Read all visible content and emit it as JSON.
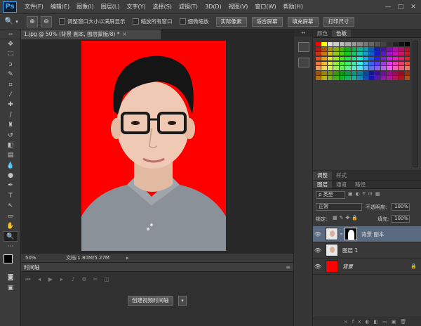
{
  "app": {
    "logo": "Ps"
  },
  "menu": [
    "文件(F)",
    "编辑(E)",
    "图像(I)",
    "图层(L)",
    "文字(Y)",
    "选择(S)",
    "滤镜(T)",
    "3D(D)",
    "视图(V)",
    "窗口(W)",
    "帮助(H)"
  ],
  "window_controls": [
    "—",
    "□",
    "✕"
  ],
  "options": {
    "chk1": "调整窗口大小以满屏显示",
    "chk2": "缩放所有窗口",
    "chk3": "细微缩放",
    "btn_actual": "实际像素",
    "btn_fit": "适合屏幕",
    "btn_fill": "填充屏幕",
    "btn_print": "打印尺寸"
  },
  "document": {
    "tab_title": "1.jpg @ 50% (背景 副本, 图层蒙版/8) *",
    "close": "×"
  },
  "status": {
    "zoom": "50%",
    "doc": "文档:1.80M/5.27M"
  },
  "timeline": {
    "title": "时间轴",
    "create_button": "创建视频时间轴"
  },
  "color_panel": {
    "tabs": [
      "颜色",
      "色板"
    ]
  },
  "adjust_panel": {
    "tabs": [
      "调整",
      "样式"
    ]
  },
  "layers_panel": {
    "tabs": [
      "图层",
      "通道",
      "路径"
    ],
    "filter_kind": "ρ 类型",
    "blend_mode": "正常",
    "opacity_label": "不透明度:",
    "opacity_value": "100%",
    "lock_label": "锁定:",
    "fill_label": "填充:",
    "fill_value": "100%",
    "layers": [
      "背景 副本",
      "图层 1",
      "背景"
    ]
  },
  "colors": {
    "canvas_bg": "#ff0000",
    "accent": "#31a8ff"
  }
}
